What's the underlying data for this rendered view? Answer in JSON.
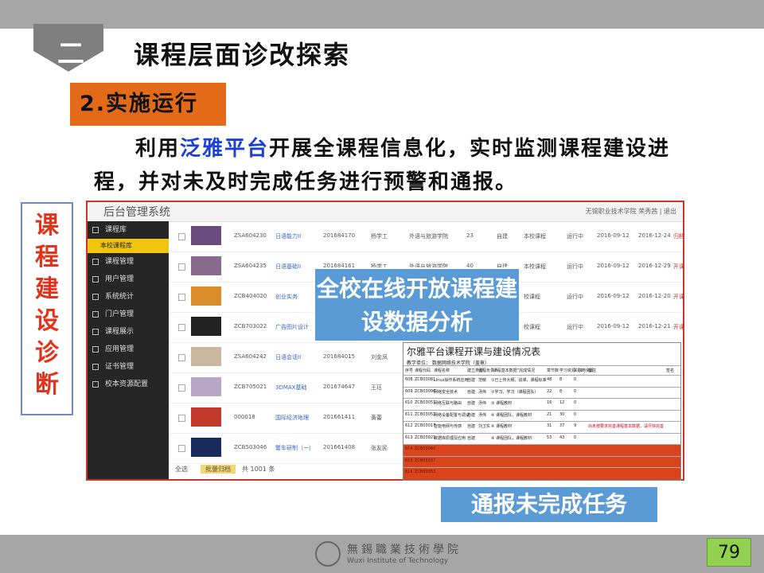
{
  "header": {
    "section_number": "二",
    "title": "课程层面诊改探索"
  },
  "subheading": "2.实施运行",
  "paragraph": {
    "before": "利用",
    "highlight": "泛雅平台",
    "after": "开展全课程信息化，实时监测课程建设进程，并对未及时完成任务进行预警和通报。"
  },
  "side_label": [
    "课",
    "程",
    "建",
    "设",
    "诊",
    "断"
  ],
  "screenshot": {
    "app_title": "后台管理系统",
    "user": "无锡职业技术学院  荣秀茜  |  退出",
    "sidebar": [
      {
        "label": "课程库",
        "sub": false
      },
      {
        "label": "本校课程库",
        "sub": true
      },
      {
        "label": "课程管理",
        "sub": false
      },
      {
        "label": "用户管理",
        "sub": false
      },
      {
        "label": "系统统计",
        "sub": false
      },
      {
        "label": "门户管理",
        "sub": false
      },
      {
        "label": "课程展示",
        "sub": false
      },
      {
        "label": "应用管理",
        "sub": false
      },
      {
        "label": "证书管理",
        "sub": false
      },
      {
        "label": "校本资源配置",
        "sub": false
      }
    ],
    "rows": [
      {
        "code": "ZSA604230",
        "name": "日语能力II",
        "num": "201684170",
        "teacher": "杨学工",
        "dept": "外语与旅游学院",
        "count": "23",
        "type": "自建",
        "kind": "本校课程",
        "status": "运行中",
        "start": "2016-09-12",
        "end": "2016-12-24",
        "op": "归档",
        "thumb": "#6b4a7d"
      },
      {
        "code": "ZSA604235",
        "name": "日语基础II",
        "num": "201684161",
        "teacher": "杨学工",
        "dept": "外语与旅游学院",
        "count": "40",
        "type": "自建",
        "kind": "本校课程",
        "status": "运行中",
        "start": "2016-09-12",
        "end": "2016-12-29",
        "op": "开课 归档",
        "thumb": "#8a6a8e"
      },
      {
        "code": "ZCB404020",
        "name": "创业实务",
        "num": "",
        "teacher": "",
        "dept": "",
        "count": "",
        "type": "",
        "kind": "校课程",
        "status": "运行中",
        "start": "2016-09-12",
        "end": "2016-12-20",
        "op": "开课 归档",
        "thumb": "#d98c2a"
      },
      {
        "code": "ZCB703022",
        "name": "广告图片设计",
        "num": "",
        "teacher": "",
        "dept": "",
        "count": "",
        "type": "",
        "kind": "校课程",
        "status": "运行中",
        "start": "2016-09-12",
        "end": "2016-12-21",
        "op": "开课 归档",
        "thumb": "#222222"
      },
      {
        "code": "ZSA604242",
        "name": "日语会话II",
        "num": "201684015",
        "teacher": "刘金凤",
        "dept": "",
        "count": "",
        "type": "",
        "kind": "",
        "status": "",
        "start": "",
        "end": "",
        "op": "",
        "thumb": "#c8b8a0"
      },
      {
        "code": "ZCB705021",
        "name": "3DMAX基础",
        "num": "201674647",
        "teacher": "王珏",
        "dept": "",
        "count": "",
        "type": "",
        "kind": "",
        "status": "",
        "start": "",
        "end": "",
        "op": "",
        "thumb": "#b8a8c8"
      },
      {
        "code": "000018",
        "name": "国际经济地理",
        "num": "201661411",
        "teacher": "黄蕾",
        "dept": "",
        "count": "",
        "type": "",
        "kind": "",
        "status": "",
        "start": "",
        "end": "",
        "op": "",
        "thumb": "#c0392b"
      },
      {
        "code": "ZCB503046",
        "name": "警车研制（一）",
        "num": "201661408",
        "teacher": "张友民",
        "dept": "",
        "count": "",
        "type": "",
        "kind": "",
        "status": "",
        "start": "",
        "end": "",
        "op": "",
        "thumb": "#1a2a5a"
      }
    ],
    "footer": {
      "select_all": "全选",
      "archive_btn": "批量归档",
      "total": "共 1001 条"
    }
  },
  "overlay_analysis": "全校在线开放课程建设数据分析",
  "table": {
    "title": "尔雅平台课程开课与建设情况表",
    "subtitle": "教学单位：          数据网络技术学院（盖章）",
    "columns": [
      "序号",
      "课程代码",
      "课程名称",
      "建立类型",
      "课程负责人",
      "“课程基本数据”完成情况",
      "章节数",
      "学习资源（个）",
      "关联的资源",
      "备注",
      "",
      "签名"
    ],
    "rows": [
      {
        "no": "608",
        "code": "ZCB03081",
        "name": "Linux操作系统应用",
        "type": "自建",
        "owner": "范敏",
        "status": "①已上传大纲，说课，课程标准",
        "ch": "48",
        "res": "8",
        "rel": "0",
        "note": "",
        "red": false
      },
      {
        "no": "609",
        "code": "ZCB03096",
        "name": "网络安全技术",
        "type": "自建",
        "owner": "汤伟",
        "status": "②学习，学习（课程团队）",
        "ch": "22",
        "res": "8",
        "rel": "0",
        "note": "",
        "red": false
      },
      {
        "no": "610",
        "code": "ZCB03051",
        "name": "网络互联与路由",
        "type": "自建",
        "owner": "汤伟",
        "status": "③ 课程教材",
        "ch": "16",
        "res": "12",
        "rel": "0",
        "note": "",
        "red": false
      },
      {
        "no": "611",
        "code": "ZCB03052",
        "name": "网络设备配置与调试",
        "type": "自建",
        "owner": "汤伟",
        "status": "④ 课程团队，课程教材",
        "ch": "21",
        "res": "30",
        "rel": "0",
        "note": "",
        "red": false
      },
      {
        "no": "612",
        "code": "ZCB03017",
        "name": "智能电网与传感",
        "type": "自建",
        "owner": "刘卫东",
        "status": "④ 课程教材",
        "ch": "31",
        "res": "37",
        "rel": "9",
        "note": "尚未按要求完善课程基本数据，请尽快完善",
        "red": false
      },
      {
        "no": "613",
        "code": "ZCB03021",
        "name": "数据库原理及应用",
        "type": "自建",
        "owner": "",
        "status": "④ 课程团队，课程教材",
        "ch": "53",
        "res": "43",
        "rel": "0",
        "note": "",
        "red": false
      },
      {
        "no": "614",
        "code": "ZCB03040",
        "name": "",
        "type": "",
        "owner": "",
        "status": "",
        "ch": "",
        "res": "",
        "rel": "",
        "note": "",
        "red": true
      },
      {
        "no": "615",
        "code": "ZCB03037",
        "name": "",
        "type": "",
        "owner": "",
        "status": "",
        "ch": "",
        "res": "",
        "rel": "",
        "note": "",
        "red": true
      },
      {
        "no": "616",
        "code": "ZCB03053",
        "name": "",
        "type": "",
        "owner": "",
        "status": "",
        "ch": "",
        "res": "",
        "rel": "",
        "note": "",
        "red": true
      }
    ]
  },
  "overlay_notice": "通报未完成任务",
  "footer": {
    "school_cn": "無錫職業技術學院",
    "school_en": "Wuxi Institute of Technology",
    "page": "79"
  },
  "colors": {
    "accent_orange": "#e26a19",
    "highlight_blue": "#1c3fd6",
    "label_red": "#e0351c",
    "overlay_blue": "#5b9bd5",
    "page_green": "#92d050",
    "bar_gray": "#a6a6a6"
  }
}
